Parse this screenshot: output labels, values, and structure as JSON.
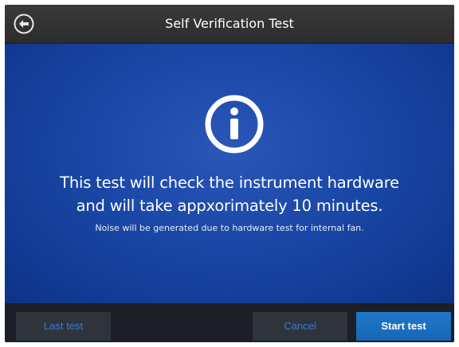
{
  "header": {
    "title": "Self Verification Test",
    "back_icon": "back-arrow-circle-icon"
  },
  "main": {
    "icon": "info-circle-icon",
    "message_line_1": "This test will check the instrument hardware",
    "message_line_2": "and will take appxorimately 10 minutes.",
    "note": "Noise will be generated due to hardware test for internal fan."
  },
  "footer": {
    "last_test_label": "Last test",
    "cancel_label": "Cancel",
    "start_test_label": "Start test"
  },
  "colors": {
    "header_bg": "#333333",
    "main_bg": "#1a47a6",
    "footer_bg": "#1c1f27",
    "secondary_button_bg": "#2e333c",
    "secondary_button_text": "#3f78cf",
    "primary_button_bg": "#1b6fbf",
    "text": "#ffffff"
  }
}
